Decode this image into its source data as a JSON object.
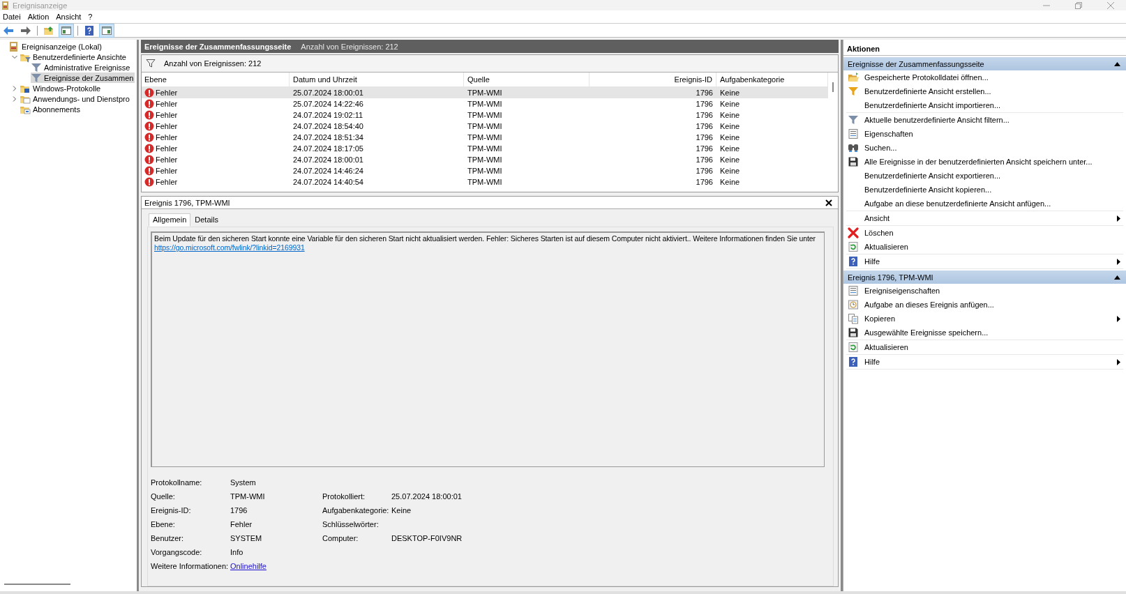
{
  "window": {
    "title": "Ereignisanzeige"
  },
  "menu": [
    {
      "label": "Datei"
    },
    {
      "label": "Aktion"
    },
    {
      "label": "Ansicht"
    },
    {
      "label": "?"
    }
  ],
  "toolbar": [
    [
      {
        "kind": "back",
        "selected": false
      },
      {
        "kind": "forward",
        "selected": false
      }
    ],
    [
      {
        "kind": "up",
        "selected": false
      },
      {
        "kind": "tree",
        "selected": true
      }
    ],
    [
      {
        "kind": "help",
        "selected": false
      },
      {
        "kind": "pane",
        "selected": true
      }
    ]
  ],
  "tree": [
    {
      "label": "Ereignisanzeige (Lokal)",
      "kind": "log",
      "selected": false,
      "children": [
        {
          "label": "Benutzerdefinierte Ansichte",
          "kind": "folder-filter",
          "expanded": true,
          "selected": false,
          "children": [
            {
              "label": "Administrative Ereignisse",
              "kind": "filter",
              "selected": false
            },
            {
              "label": "Ereignisse der Zusammen",
              "kind": "filter",
              "selected": true
            }
          ]
        },
        {
          "label": "Windows-Protokolle",
          "kind": "folder-log",
          "expanded": false,
          "selected": false
        },
        {
          "label": "Anwendungs- und Dienstpro",
          "kind": "folder",
          "expanded": false,
          "selected": false
        },
        {
          "label": "Abonnements",
          "kind": "folder-sub",
          "selected": false
        }
      ]
    }
  ],
  "view": {
    "title": "Ereignisse der Zusammenfassungsseite",
    "count": "Anzahl von Ereignissen: 212",
    "filter_text": "Anzahl von Ereignissen: 212"
  },
  "events": {
    "columns": [
      {
        "label": "Ebene",
        "kind": "text"
      },
      {
        "label": "Datum und Uhrzeit",
        "kind": "text"
      },
      {
        "label": "Quelle",
        "kind": "text"
      },
      {
        "label": "Ereignis-ID",
        "kind": "number"
      },
      {
        "label": "Aufgabenkategorie",
        "kind": "text"
      }
    ],
    "rows": [
      {
        "kind": "error",
        "selected": true,
        "cells": [
          "Fehler",
          "25.07.2024 18:00:01",
          "TPM-WMI",
          "1796",
          "Keine"
        ]
      },
      {
        "kind": "error",
        "selected": false,
        "cells": [
          "Fehler",
          "25.07.2024 14:22:46",
          "TPM-WMI",
          "1796",
          "Keine"
        ]
      },
      {
        "kind": "error",
        "selected": false,
        "cells": [
          "Fehler",
          "24.07.2024 19:02:11",
          "TPM-WMI",
          "1796",
          "Keine"
        ]
      },
      {
        "kind": "error",
        "selected": false,
        "cells": [
          "Fehler",
          "24.07.2024 18:54:40",
          "TPM-WMI",
          "1796",
          "Keine"
        ]
      },
      {
        "kind": "error",
        "selected": false,
        "cells": [
          "Fehler",
          "24.07.2024 18:51:34",
          "TPM-WMI",
          "1796",
          "Keine"
        ]
      },
      {
        "kind": "error",
        "selected": false,
        "cells": [
          "Fehler",
          "24.07.2024 18:17:05",
          "TPM-WMI",
          "1796",
          "Keine"
        ]
      },
      {
        "kind": "error",
        "selected": false,
        "cells": [
          "Fehler",
          "24.07.2024 18:00:01",
          "TPM-WMI",
          "1796",
          "Keine"
        ]
      },
      {
        "kind": "error",
        "selected": false,
        "cells": [
          "Fehler",
          "24.07.2024 14:46:24",
          "TPM-WMI",
          "1796",
          "Keine"
        ]
      },
      {
        "kind": "error",
        "selected": false,
        "cells": [
          "Fehler",
          "24.07.2024 14:40:54",
          "TPM-WMI",
          "1796",
          "Keine"
        ]
      }
    ]
  },
  "detail": {
    "title": "Ereignis 1796, TPM-WMI",
    "tabs": [
      {
        "label": "Allgemein",
        "selected": true
      },
      {
        "label": "Details",
        "selected": false
      }
    ],
    "description": "Beim Update für den sicheren Start konnte eine Variable für den sicheren Start nicht aktualisiert werden. Fehler: Sicheres Starten ist auf diesem Computer nicht aktiviert.. Weitere Informationen finden Sie unter",
    "link": "https://go.microsoft.com/fwlink/?linkid=2169931",
    "properties": [
      {
        "left": {
          "label": "Protokollname:",
          "value": "System"
        }
      },
      {
        "left": {
          "label": "Quelle:",
          "value": "TPM-WMI"
        },
        "right": {
          "label": "Protokolliert:",
          "value": "25.07.2024 18:00:01"
        }
      },
      {
        "left": {
          "label": "Ereignis-ID:",
          "value": "1796"
        },
        "right": {
          "label": "Aufgabenkategorie:",
          "value": "Keine"
        }
      },
      {
        "left": {
          "label": "Ebene:",
          "value": "Fehler"
        },
        "right": {
          "label": "Schlüsselwörter:"
        }
      },
      {
        "left": {
          "label": "Benutzer:",
          "value": "SYSTEM"
        },
        "right": {
          "label": "Computer:",
          "value": "DESKTOP-F0IV9NR"
        }
      },
      {
        "left": {
          "label": "Vorgangscode:",
          "value": "Info"
        }
      },
      {
        "left": {
          "label": "Weitere Informationen:",
          "value": "Onlinehilfe",
          "kind": "link"
        }
      }
    ]
  },
  "actions": {
    "title": "Aktionen",
    "sections": [
      {
        "title": "Ereignisse der Zusammenfassungsseite",
        "expanded": true,
        "groups": [
          [
            {
              "label": "Gespeicherte Protokolldatei öffnen...",
              "kind": "open"
            },
            {
              "label": "Benutzerdefinierte Ansicht erstellen...",
              "kind": "create"
            },
            {
              "label": "Benutzerdefinierte Ansicht importieren...",
              "kind": "plain"
            }
          ],
          [
            {
              "label": "Aktuelle benutzerdefinierte Ansicht filtern...",
              "kind": "filter"
            },
            {
              "label": "Eigenschaften",
              "kind": "properties"
            },
            {
              "label": "Suchen...",
              "kind": "search"
            },
            {
              "label": "Alle Ereignisse in der benutzerdefinierten Ansicht speichern unter...",
              "kind": "save"
            },
            {
              "label": "Benutzerdefinierte Ansicht exportieren...",
              "kind": "plain"
            },
            {
              "label": "Benutzerdefinierte Ansicht kopieren...",
              "kind": "plain"
            },
            {
              "label": "Aufgabe an diese benutzerdefinierte Ansicht anfügen...",
              "kind": "plain"
            }
          ],
          [
            {
              "label": "Ansicht",
              "kind": "plain",
              "submenu": true
            }
          ],
          [
            {
              "label": "Löschen",
              "kind": "delete"
            },
            {
              "label": "Aktualisieren",
              "kind": "refresh"
            }
          ],
          [
            {
              "label": "Hilfe",
              "kind": "help",
              "submenu": true
            }
          ]
        ]
      },
      {
        "title": "Ereignis 1796, TPM-WMI",
        "expanded": true,
        "groups": [
          [
            {
              "label": "Ereigniseigenschaften",
              "kind": "properties"
            },
            {
              "label": "Aufgabe an dieses Ereignis anfügen...",
              "kind": "task"
            },
            {
              "label": "Kopieren",
              "kind": "copy",
              "submenu": true
            },
            {
              "label": "Ausgewählte Ereignisse speichern...",
              "kind": "save"
            }
          ],
          [
            {
              "label": "Aktualisieren",
              "kind": "refresh"
            }
          ],
          [
            {
              "label": "Hilfe",
              "kind": "help",
              "submenu": true
            }
          ]
        ]
      }
    ]
  }
}
